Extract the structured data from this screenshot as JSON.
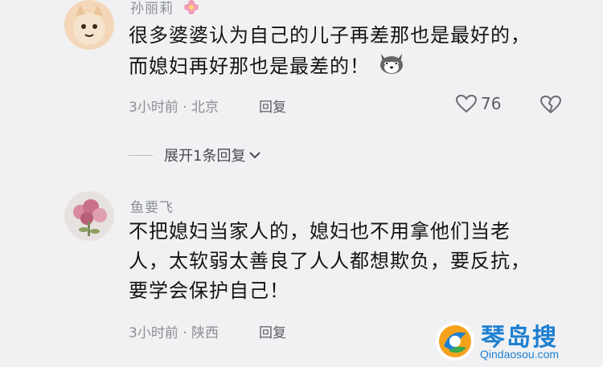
{
  "comments": [
    {
      "username": "孙丽莉",
      "text": "很多婆婆认为自己的儿子再差那也是最好的，而媳妇再好那也是最差的！",
      "emoji_icon": "husky-dog-icon",
      "meta": "3小时前 · 北京",
      "reply_label": "回复",
      "like_count": "76",
      "expand_label": "展开1条回复"
    },
    {
      "username": "鱼要飞",
      "text": "不把媳妇当家人的，媳妇也不用拿他们当老人，太软弱太善良了人人都想欺负，要反抗，要学会保护自己！",
      "meta": "3小时前 · 陕西",
      "reply_label": "回复"
    }
  ],
  "watermark": {
    "title": "琴岛搜",
    "url": "Qindaosou.com"
  },
  "colors": {
    "background": "#f1f1f3",
    "text": "#141414",
    "meta": "#8e8e93",
    "watermark": "#1d7fd1"
  }
}
